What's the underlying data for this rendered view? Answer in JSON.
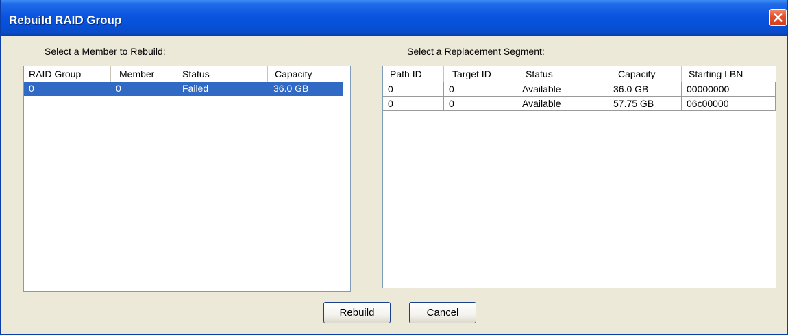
{
  "window": {
    "title": "Rebuild RAID Group",
    "close_icon": "close-icon"
  },
  "members": {
    "label": "Select a Member to Rebuild:",
    "columns": [
      "RAID Group",
      "Member",
      "Status",
      "Capacity"
    ],
    "rows": [
      {
        "raid_group": "0",
        "member": "0",
        "status": "Failed",
        "capacity": "36.0 GB",
        "selected": true
      }
    ]
  },
  "segments": {
    "label": "Select a Replacement Segment:",
    "columns": [
      "Path ID",
      "Target ID",
      "Status",
      "Capacity",
      "Starting LBN"
    ],
    "rows": [
      {
        "path_id": "0",
        "target_id": "0",
        "status": "Available",
        "capacity": "36.0 GB",
        "starting_lbn": "00000000"
      },
      {
        "path_id": "0",
        "target_id": "0",
        "status": "Available",
        "capacity": "57.75 GB",
        "starting_lbn": "06c00000"
      }
    ]
  },
  "buttons": {
    "rebuild": {
      "accel": "R",
      "rest": "ebuild"
    },
    "cancel": {
      "accel": "C",
      "rest": "ancel"
    }
  },
  "colors": {
    "selection": "#316ac5",
    "titlebar": "#0a54e0",
    "window_bg": "#ece9d8"
  }
}
